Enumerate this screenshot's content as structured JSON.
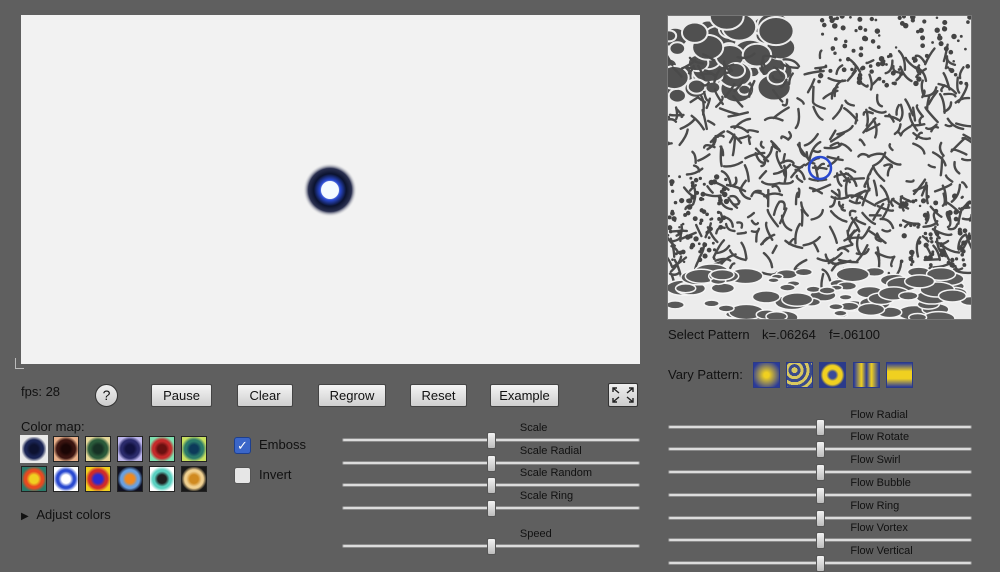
{
  "status": {
    "fps": "fps: 28"
  },
  "toolbar": {
    "help_label": "?",
    "pause_label": "Pause",
    "clear_label": "Clear",
    "regrow_label": "Regrow",
    "reset_label": "Reset",
    "example_label": "Example"
  },
  "colormap": {
    "label": "Color map:",
    "selected_index": 0,
    "swatches": [
      {
        "name": "swatch-1",
        "bg": "#e9e9e9",
        "ring": "#1a2454",
        "core": "#0d1230"
      },
      {
        "name": "swatch-2",
        "bg": "#e8b08a",
        "ring": "#3a1410",
        "core": "#1a0605"
      },
      {
        "name": "swatch-3",
        "bg": "#e6d89a",
        "ring": "#2a5a3a",
        "core": "#173225"
      },
      {
        "name": "swatch-4",
        "bg": "#bfb8ee",
        "ring": "#2a2a6a",
        "core": "#121240"
      },
      {
        "name": "swatch-5",
        "bg": "#7fe0b0",
        "ring": "#c42a2a",
        "core": "#6a1010"
      },
      {
        "name": "swatch-6",
        "bg": "#c8e060",
        "ring": "#2a7a6a",
        "core": "#0c3a5a"
      },
      {
        "name": "swatch-7",
        "bg": "#2a7a6a",
        "ring": "#e84a20",
        "core": "#f0d020"
      },
      {
        "name": "swatch-8",
        "bg": "#ffffff",
        "ring": "#2a4ad0",
        "core": "#ffffff"
      },
      {
        "name": "swatch-9",
        "bg": "#f0d020",
        "ring": "#d02a2a",
        "core": "#2a2ad0"
      },
      {
        "name": "swatch-10",
        "bg": "#101020",
        "ring": "#6aa0e0",
        "core": "#f08a20"
      },
      {
        "name": "swatch-11",
        "bg": "#ffffff",
        "ring": "#5ad0c0",
        "core": "#202020"
      },
      {
        "name": "swatch-12",
        "bg": "#181818",
        "ring": "#f0d090",
        "core": "#d08a20"
      }
    ]
  },
  "adjust_colors": {
    "arrow": "▶",
    "label": "Adjust colors"
  },
  "options": {
    "emboss": {
      "label": "Emboss",
      "checked": true
    },
    "invert": {
      "label": "Invert",
      "checked": false
    }
  },
  "scale_sliders": [
    {
      "label": "Scale",
      "value": 0.5
    },
    {
      "label": "Scale Radial",
      "value": 0.5
    },
    {
      "label": "Scale Random",
      "value": 0.5
    },
    {
      "label": "Scale Ring",
      "value": 0.5
    },
    {
      "label": "Speed",
      "value": 0.5
    }
  ],
  "pattern": {
    "select_label": "Select Pattern",
    "k_value": "k=.06264",
    "f_value": "f=.06100",
    "vary_label": "Vary Pattern:",
    "vary_presets": [
      "vary-spots",
      "vary-blobs",
      "vary-ring",
      "vary-stripes-vertical",
      "vary-stripes-horizontal"
    ]
  },
  "flow_sliders": [
    {
      "label": "Flow Radial",
      "value": 0.5
    },
    {
      "label": "Flow Rotate",
      "value": 0.5
    },
    {
      "label": "Flow Swirl",
      "value": 0.5
    },
    {
      "label": "Flow Bubble",
      "value": 0.5
    },
    {
      "label": "Flow Ring",
      "value": 0.5
    },
    {
      "label": "Flow Vortex",
      "value": 0.5
    },
    {
      "label": "Flow Vertical",
      "value": 0.5
    }
  ],
  "colors": {
    "accent": "#2a4ad0",
    "page_bg": "#5f5f5f",
    "canvas_bg": "#f2f2f2"
  }
}
